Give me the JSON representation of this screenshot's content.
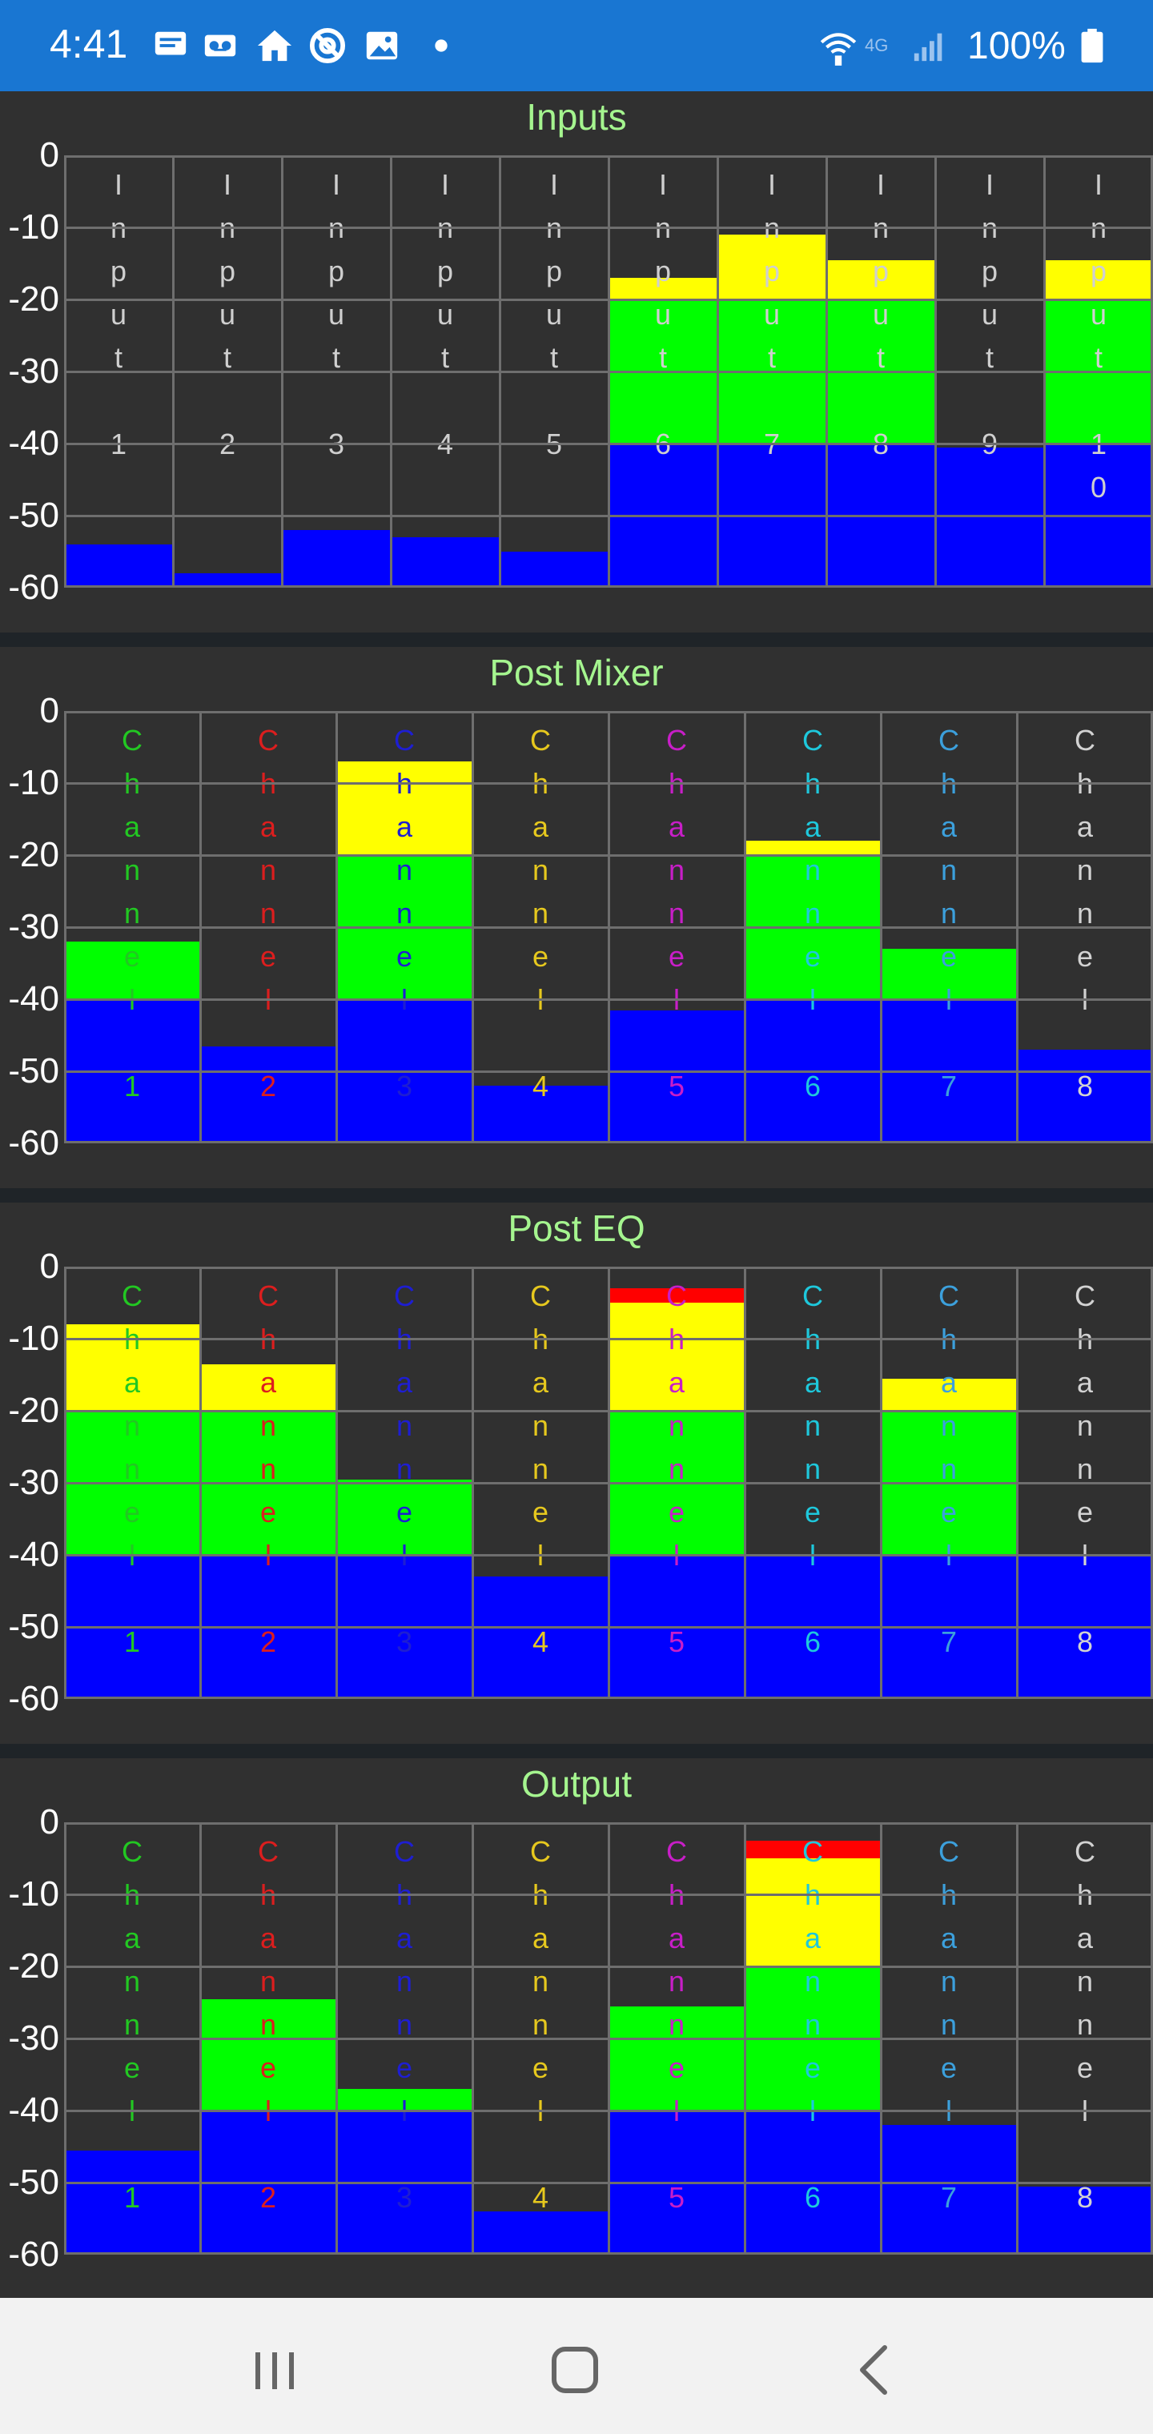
{
  "status_bar": {
    "time": "4:41",
    "network": "4G",
    "battery": "100%",
    "left_icons": [
      "message-icon",
      "voicemail-icon",
      "home-icon",
      "at-sign-icon",
      "image-icon",
      "dot-icon"
    ],
    "right_icons": [
      "wifi-calling-icon",
      "cellular-signal-icon",
      "battery-icon"
    ]
  },
  "y_axis": {
    "ticks": [
      "0",
      "-10",
      "-20",
      "-30",
      "-40",
      "-50",
      "-60"
    ],
    "min": -60,
    "max": 0
  },
  "zones": {
    "blue": {
      "from": -60,
      "to": -40,
      "color": "#0000ff"
    },
    "green": {
      "from": -40,
      "to": -20,
      "color": "#00ff00"
    },
    "yellow": {
      "from": -20,
      "to": -5,
      "color": "#ffff00"
    },
    "red": {
      "from": -5,
      "to": 0,
      "color": "#ff0000"
    }
  },
  "colors": {
    "panel_bg": "#303030",
    "grid_line": "#6e6e6e",
    "title": "#a5f58f",
    "status_bar": "#1976d2"
  },
  "panels": [
    {
      "title": "Inputs",
      "meters": [
        {
          "label": "Input 1",
          "level": -54,
          "color": "#cfcfcf"
        },
        {
          "label": "Input 2",
          "level": -58,
          "color": "#cfcfcf"
        },
        {
          "label": "Input 3",
          "level": -52,
          "color": "#cfcfcf"
        },
        {
          "label": "Input 4",
          "level": -53,
          "color": "#cfcfcf"
        },
        {
          "label": "Input 5",
          "level": -55,
          "color": "#cfcfcf"
        },
        {
          "label": "Input 6",
          "level": -17,
          "color": "#cfcfcf"
        },
        {
          "label": "Input 7",
          "level": -11,
          "color": "#cfcfcf"
        },
        {
          "label": "Input 8",
          "level": -14.5,
          "color": "#cfcfcf"
        },
        {
          "label": "Input 9",
          "level": -40.5,
          "color": "#cfcfcf"
        },
        {
          "label": "Input 10",
          "level": -14.5,
          "color": "#cfcfcf"
        }
      ]
    },
    {
      "title": "Post Mixer",
      "meters": [
        {
          "label": "Channel 1",
          "level": -32,
          "color": "#22c822"
        },
        {
          "label": "Channel 2",
          "level": -46.5,
          "color": "#dc1e1e"
        },
        {
          "label": "Channel 3",
          "level": -7,
          "color": "#1e1ed2"
        },
        {
          "label": "Channel 4",
          "level": -52,
          "color": "#e6c81e"
        },
        {
          "label": "Channel 5",
          "level": -41.5,
          "color": "#c81ec8"
        },
        {
          "label": "Channel 6",
          "level": -18,
          "color": "#1ec8dc"
        },
        {
          "label": "Channel 7",
          "level": -33,
          "color": "#3ca0dc"
        },
        {
          "label": "Channel 8",
          "level": -47,
          "color": "#d2d2d2"
        }
      ]
    },
    {
      "title": "Post EQ",
      "meters": [
        {
          "label": "Channel 1",
          "level": -8,
          "color": "#22c822"
        },
        {
          "label": "Channel 2",
          "level": -13.5,
          "color": "#dc1e1e"
        },
        {
          "label": "Channel 3",
          "level": -29.5,
          "color": "#1e1ed2"
        },
        {
          "label": "Channel 4",
          "level": -43,
          "color": "#e6c81e"
        },
        {
          "label": "Channel 5",
          "level": -3,
          "color": "#c81ec8"
        },
        {
          "label": "Channel 6",
          "level": -40,
          "color": "#1ec8dc"
        },
        {
          "label": "Channel 7",
          "level": -15.5,
          "color": "#3ca0dc"
        },
        {
          "label": "Channel 8",
          "level": -40,
          "color": "#d2d2d2"
        }
      ]
    },
    {
      "title": "Output",
      "meters": [
        {
          "label": "Channel 1",
          "level": -45.5,
          "color": "#22c822"
        },
        {
          "label": "Channel 2",
          "level": -24.5,
          "color": "#dc1e1e"
        },
        {
          "label": "Channel 3",
          "level": -37,
          "color": "#1e1ed2"
        },
        {
          "label": "Channel 4",
          "level": -54,
          "color": "#e6c81e"
        },
        {
          "label": "Channel 5",
          "level": -25.5,
          "color": "#c81ec8"
        },
        {
          "label": "Channel 6",
          "level": -2.5,
          "color": "#1ec8dc"
        },
        {
          "label": "Channel 7",
          "level": -42,
          "color": "#3ca0dc"
        },
        {
          "label": "Channel 8",
          "level": -50.5,
          "color": "#d2d2d2"
        }
      ]
    }
  ],
  "nav_bar": {
    "buttons": [
      "recent-apps-button",
      "home-button",
      "back-button"
    ]
  }
}
